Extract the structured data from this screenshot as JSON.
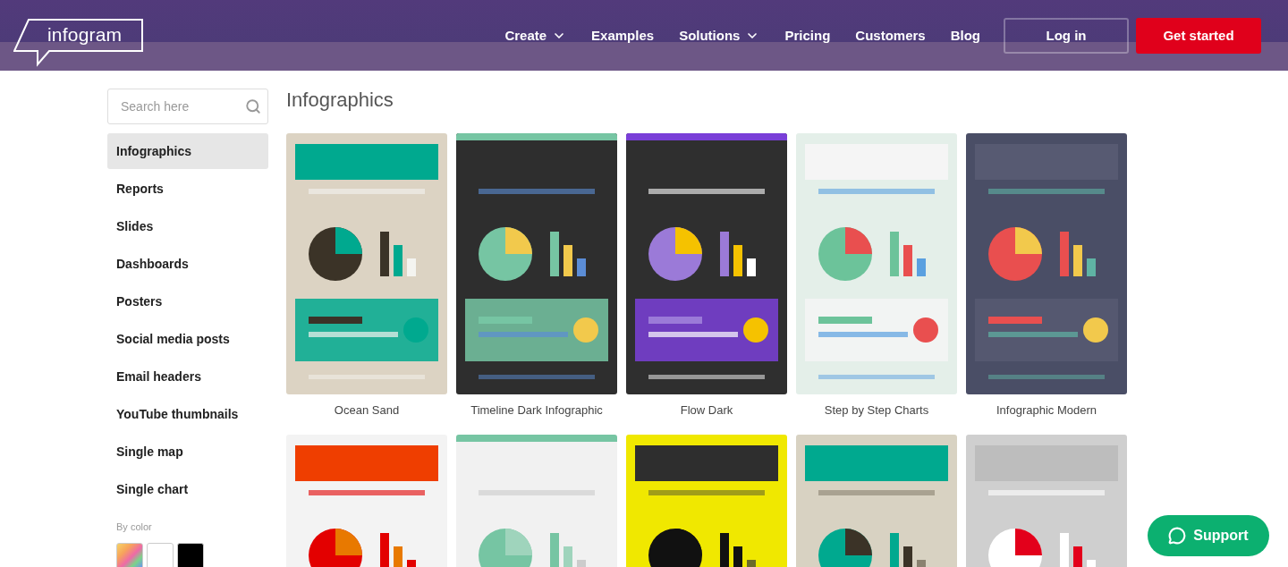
{
  "header": {
    "logo": "infogram",
    "nav": [
      {
        "label": "Create",
        "dropdown": true
      },
      {
        "label": "Examples",
        "dropdown": false
      },
      {
        "label": "Solutions",
        "dropdown": true
      },
      {
        "label": "Pricing",
        "dropdown": false
      },
      {
        "label": "Customers",
        "dropdown": false
      },
      {
        "label": "Blog",
        "dropdown": false
      }
    ],
    "login": "Log in",
    "cta": "Get started"
  },
  "sidebar": {
    "search": {
      "placeholder": "Search here"
    },
    "items": [
      {
        "label": "Infographics",
        "selected": true
      },
      {
        "label": "Reports",
        "selected": false
      },
      {
        "label": "Slides",
        "selected": false
      },
      {
        "label": "Dashboards",
        "selected": false
      },
      {
        "label": "Posters",
        "selected": false
      },
      {
        "label": "Social media posts",
        "selected": false
      },
      {
        "label": "Email headers",
        "selected": false
      },
      {
        "label": "YouTube thumbnails",
        "selected": false
      },
      {
        "label": "Single map",
        "selected": false
      },
      {
        "label": "Single chart",
        "selected": false
      }
    ],
    "color_heading": "By color",
    "colors": [
      {
        "kind": "gradient"
      },
      {
        "kind": "solid",
        "color": "#ffffff"
      },
      {
        "kind": "solid",
        "color": "#000000"
      }
    ]
  },
  "heading": "Infographics",
  "templates": [
    {
      "name": "Ocean Sand",
      "kind": "picture"
    },
    {
      "name": "Timeline Dark Infographic",
      "kind": "picture"
    },
    {
      "name": "Flow Dark",
      "kind": "picture"
    },
    {
      "name": "Step by Step Charts",
      "kind": "picture"
    },
    {
      "name": "Infographic Modern",
      "kind": "picture"
    },
    {
      "kind": "picture"
    },
    {
      "kind": "picture"
    },
    {
      "kind": "picture"
    },
    {
      "kind": "picture"
    },
    {
      "kind": "picture"
    }
  ],
  "support": "Support"
}
